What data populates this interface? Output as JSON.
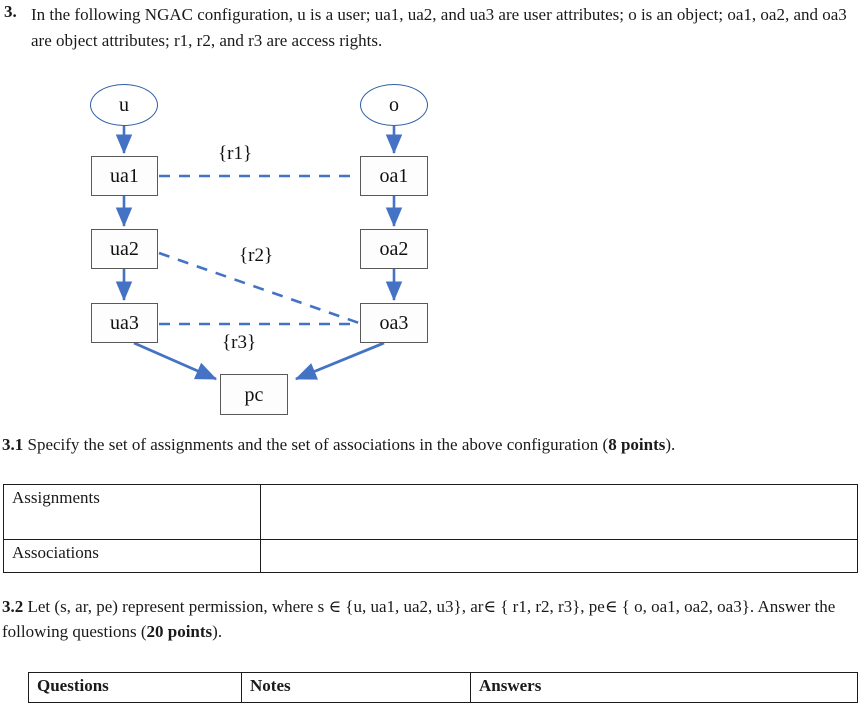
{
  "question": {
    "number": "3.",
    "text": "In the following NGAC configuration, u is a user; ua1, ua2, and ua3 are user attributes; o is an object; oa1, oa2, and oa3 are object attributes; r1, r2, and r3 are access rights."
  },
  "diagram": {
    "nodes": {
      "u": "u",
      "o": "o",
      "ua1": "ua1",
      "ua2": "ua2",
      "ua3": "ua3",
      "oa1": "oa1",
      "oa2": "oa2",
      "oa3": "oa3",
      "pc": "pc"
    },
    "edge_labels": {
      "r1": "{r1}",
      "r2": "{r2}",
      "r3": "{r3}"
    },
    "colors": {
      "arrow": "#4472c4",
      "dashed": "#4472c4",
      "ellipse_stroke": "#2e5fa3",
      "box_stroke": "#595959"
    },
    "assignments": [
      "u -> ua1",
      "ua1 -> ua2",
      "ua2 -> ua3",
      "ua3 -> pc",
      "o -> oa1",
      "oa1 -> oa2",
      "oa2 -> oa3",
      "oa3 -> pc"
    ],
    "associations": [
      "ua1 -- {r1} -- oa1",
      "ua2 -- {r2} -- oa3",
      "ua3 -- {r3} -- oa3"
    ]
  },
  "section31": {
    "number": "3.1",
    "text_before": " Specify the set of assignments and the set of associations in the above configuration (",
    "points": "8 points",
    "text_after": ")."
  },
  "table1": {
    "rows": [
      {
        "label": "Assignments",
        "answer": ""
      },
      {
        "label": "Associations",
        "answer": ""
      }
    ]
  },
  "section32": {
    "number": "3.2",
    "text": " Let (s, ar, pe) represent permission, where s ∈ {u, ua1, ua2, u3}, ar∈ { r1, r2, r3}, pe∈ { o, oa1, oa2, oa3}. Answer the following questions (",
    "points": "20 points",
    "text_after": ")."
  },
  "table2": {
    "headers": [
      "Questions",
      "Notes",
      "Answers"
    ]
  }
}
